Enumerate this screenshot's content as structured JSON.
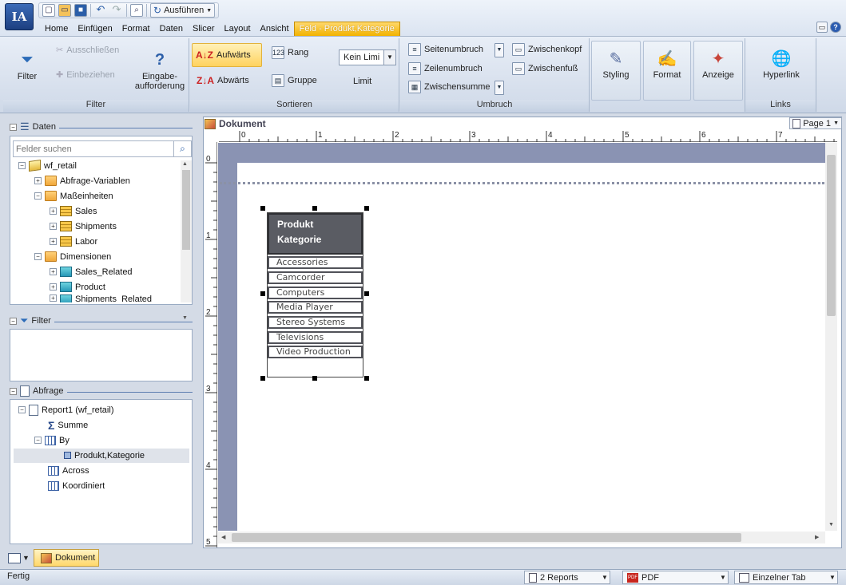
{
  "quick_access": {
    "run_label": "Ausführen"
  },
  "menu": {
    "items": [
      "Home",
      "Einfügen",
      "Format",
      "Daten",
      "Slicer",
      "Layout",
      "Ansicht"
    ],
    "context_tab": "Feld - Produkt,Kategorie"
  },
  "ribbon": {
    "filter_group": {
      "title": "Filter",
      "filter_label": "Filter",
      "exclude_label": "Ausschließen",
      "include_label": "Einbeziehen",
      "prompt_label_1": "Eingabe-",
      "prompt_label_2": "aufforderung"
    },
    "sort_group": {
      "title": "Sortieren",
      "ascending_label": "Aufwärts",
      "descending_label": "Abwärts",
      "rank_label": "Rang",
      "group_label": "Gruppe",
      "limit_value": "Kein Limi",
      "limit_label": "Limit"
    },
    "break_group": {
      "title": "Umbruch",
      "page_break_label": "Seitenumbruch",
      "line_break_label": "Zeilenumbruch",
      "subtotal_label": "Zwischensumme",
      "subhead_label": "Zwischenkopf",
      "subfoot_label": "Zwischenfuß"
    },
    "style_buttons": {
      "styling_label": "Styling",
      "format_label": "Format",
      "display_label": "Anzeige"
    },
    "links_group": {
      "title": "Links",
      "hyperlink_label": "Hyperlink"
    }
  },
  "data_panel": {
    "title": "Daten",
    "search_placeholder": "Felder suchen",
    "tree": {
      "root": "wf_retail",
      "query_vars": "Abfrage-Variablen",
      "measures": "Maßeinheiten",
      "sales": "Sales",
      "shipments": "Shipments",
      "labor": "Labor",
      "dimensions": "Dimensionen",
      "sales_related": "Sales_Related",
      "product": "Product",
      "shipments_related": "Shipments_Related"
    }
  },
  "filter_panel": {
    "title": "Filter"
  },
  "query_panel": {
    "title": "Abfrage",
    "report": "Report1 (wf_retail)",
    "sum": "Summe",
    "by": "By",
    "field": "Produkt,Kategorie",
    "across": "Across",
    "coordinated": "Koordiniert"
  },
  "document": {
    "title": "Dokument",
    "page_label": "Page 1",
    "ruler_h": [
      "0",
      "1",
      "2",
      "3",
      "4",
      "5",
      "6",
      "7"
    ],
    "ruler_v": [
      "0",
      "1",
      "2",
      "3",
      "4",
      "5"
    ],
    "table_header_1": "Produkt",
    "table_header_2": "Kategorie",
    "rows": [
      "Accessories",
      "Camcorder",
      "Computers",
      "Media Player",
      "Stereo Systems",
      "Televisions",
      "Video Production"
    ]
  },
  "bottom_tabs": {
    "document_tab": "Dokument"
  },
  "status": {
    "text": "Fertig",
    "reports": "2 Reports",
    "output": "PDF",
    "tab_mode": "Einzelner Tab"
  }
}
